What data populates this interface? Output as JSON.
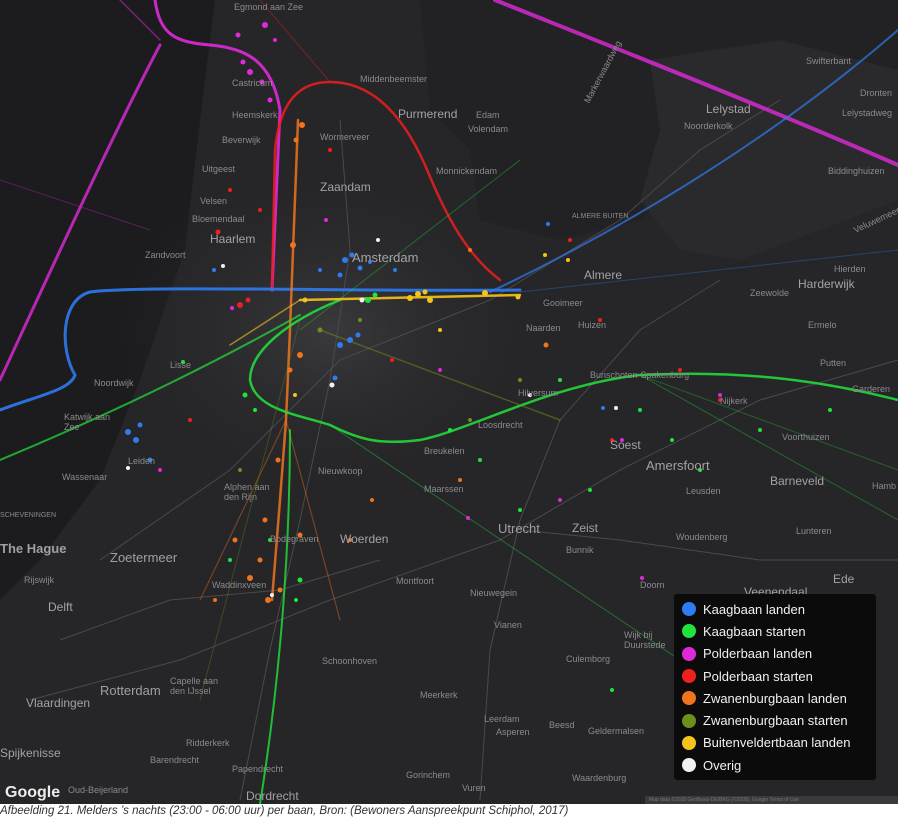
{
  "map": {
    "legend": {
      "items": [
        {
          "label": "Kaagbaan landen",
          "color": "#2f7bf0"
        },
        {
          "label": "Kaagbaan starten",
          "color": "#22e33a"
        },
        {
          "label": "Polderbaan landen",
          "color": "#e02ad9"
        },
        {
          "label": "Polderbaan starten",
          "color": "#ee1f1f"
        },
        {
          "label": "Zwanenburgbaan landen",
          "color": "#f0741e"
        },
        {
          "label": "Zwanenburgbaan starten",
          "color": "#6f8f1c"
        },
        {
          "label": "Buitenveldertbaan landen",
          "color": "#f2c41c"
        },
        {
          "label": "Overig",
          "color": "#f2f2f2"
        }
      ]
    },
    "places": [
      {
        "name": "Egmond aan Zee"
      },
      {
        "name": "Castricum"
      },
      {
        "name": "Middenbeemster"
      },
      {
        "name": "Purmerend"
      },
      {
        "name": "Edam"
      },
      {
        "name": "Volendam"
      },
      {
        "name": "Heemskerk"
      },
      {
        "name": "Beverwijk"
      },
      {
        "name": "Wormerveer"
      },
      {
        "name": "Uitgeest"
      },
      {
        "name": "Zaandam"
      },
      {
        "name": "Monnickendam"
      },
      {
        "name": "Lelystad"
      },
      {
        "name": "Noorderkolk"
      },
      {
        "name": "Markerwaardweg"
      },
      {
        "name": "Dronten"
      },
      {
        "name": "Swifterbant"
      },
      {
        "name": "Lelystadweg"
      },
      {
        "name": "Biddinghuizen"
      },
      {
        "name": "Velsen"
      },
      {
        "name": "Bloemendaal"
      },
      {
        "name": "Haarlem"
      },
      {
        "name": "Amsterdam"
      },
      {
        "name": "ALMERE BUITEN"
      },
      {
        "name": "Almere"
      },
      {
        "name": "Zandvoort"
      },
      {
        "name": "Hierden"
      },
      {
        "name": "Harderwijk"
      },
      {
        "name": "Zeewolde"
      },
      {
        "name": "Gooimeer"
      },
      {
        "name": "Huizen"
      },
      {
        "name": "Naarden"
      },
      {
        "name": "Ermelo"
      },
      {
        "name": "Putten"
      },
      {
        "name": "Noordwijk"
      },
      {
        "name": "Lisse"
      },
      {
        "name": "Katwijk aan Zee"
      },
      {
        "name": "Hilversum"
      },
      {
        "name": "Bunschoten-Spakenburg"
      },
      {
        "name": "Nijkerk"
      },
      {
        "name": "Garderen"
      },
      {
        "name": "Leiden"
      },
      {
        "name": "Loosdrecht"
      },
      {
        "name": "Breukelen"
      },
      {
        "name": "Soest"
      },
      {
        "name": "Amersfoort"
      },
      {
        "name": "Voorthuizen"
      },
      {
        "name": "Barneveld"
      },
      {
        "name": "Wassenaar"
      },
      {
        "name": "Alphen aan den Rijn"
      },
      {
        "name": "Nieuwkoop"
      },
      {
        "name": "Leusden"
      },
      {
        "name": "Maarssen"
      },
      {
        "name": "SCHEVENINGEN"
      },
      {
        "name": "The Hague"
      },
      {
        "name": "Zoetermeer"
      },
      {
        "name": "Utrecht"
      },
      {
        "name": "Zeist"
      },
      {
        "name": "Woerden"
      },
      {
        "name": "Bodegraven"
      },
      {
        "name": "Woudenberg"
      },
      {
        "name": "Lunteren"
      },
      {
        "name": "Ede"
      },
      {
        "name": "Veenendaal"
      },
      {
        "name": "Rijswijk"
      },
      {
        "name": "Delft"
      },
      {
        "name": "Waddinxveen"
      },
      {
        "name": "Montfoort"
      },
      {
        "name": "Nieuwegein"
      },
      {
        "name": "Bunnik"
      },
      {
        "name": "Doorn"
      },
      {
        "name": "Wijk bij Duurstede"
      },
      {
        "name": "Vianen"
      },
      {
        "name": "Culemborg"
      },
      {
        "name": "Schoonhoven"
      },
      {
        "name": "Capelle aan den IJssel"
      },
      {
        "name": "Rotterdam"
      },
      {
        "name": "Vlaardingen"
      },
      {
        "name": "Meerkerk"
      },
      {
        "name": "Leerdam"
      },
      {
        "name": "Asperen"
      },
      {
        "name": "Beesd"
      },
      {
        "name": "Geldermalsen"
      },
      {
        "name": "Ridderkerk"
      },
      {
        "name": "Spijkenisse"
      },
      {
        "name": "Barendrecht"
      },
      {
        "name": "Papendrecht"
      },
      {
        "name": "Gorinchem"
      },
      {
        "name": "Waardenburg"
      },
      {
        "name": "Dordrecht"
      },
      {
        "name": "Oud-Beijerland"
      },
      {
        "name": "Vuren"
      },
      {
        "name": "Hamb"
      },
      {
        "name": "Veluwemeer"
      }
    ],
    "logo": "Google",
    "attribution": "Map data ©2018 GeoBasis-DE/BKG (©2009), Google   Terms of Use"
  },
  "caption": "Afbeelding 21. Melders ’s nachts (23:00 - 06:00 uur) per baan, Bron: (Bewoners Aanspreekpunt Schiphol, 2017)"
}
